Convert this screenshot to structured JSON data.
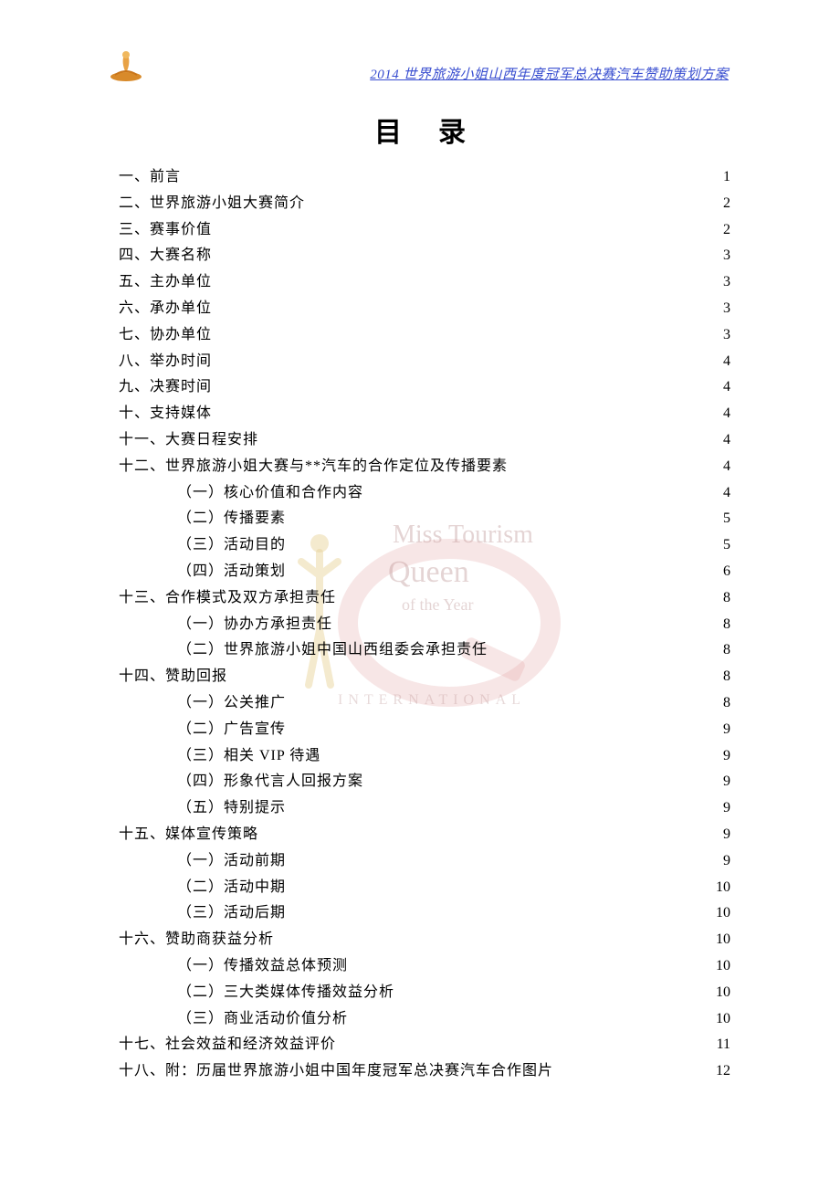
{
  "header": {
    "text": "2014 世界旅游小姐山西年度冠军总决赛汽车赞助策划方案"
  },
  "title": "目录",
  "watermark": {
    "line1": "Miss Tourism",
    "line2": "Queen",
    "line3": "of the Year",
    "line4": "INTERNATIONAL"
  },
  "toc": [
    {
      "label": "一、前言",
      "page": "1",
      "sub": false
    },
    {
      "label": "二、世界旅游小姐大赛简介",
      "page": "2",
      "sub": false
    },
    {
      "label": "三、赛事价值",
      "page": "2",
      "sub": false
    },
    {
      "label": "四、大赛名称",
      "page": "3",
      "sub": false
    },
    {
      "label": "五、主办单位",
      "page": "3",
      "sub": false
    },
    {
      "label": "六、承办单位",
      "page": "3",
      "sub": false
    },
    {
      "label": "七、协办单位",
      "page": "3",
      "sub": false
    },
    {
      "label": "八、举办时间",
      "page": "4",
      "sub": false
    },
    {
      "label": "九、决赛时间",
      "page": "4",
      "sub": false
    },
    {
      "label": "十、支持媒体",
      "page": "4",
      "sub": false
    },
    {
      "label": "十一、大赛日程安排",
      "page": "4",
      "sub": false
    },
    {
      "label": "十二、世界旅游小姐大赛与**汽车的合作定位及传播要素",
      "page": "4",
      "sub": false
    },
    {
      "label": "（一）核心价值和合作内容",
      "page": "4",
      "sub": true
    },
    {
      "label": "（二）传播要素",
      "page": "5",
      "sub": true
    },
    {
      "label": "（三）活动目的",
      "page": "5",
      "sub": true
    },
    {
      "label": "（四）活动策划",
      "page": "6",
      "sub": true
    },
    {
      "label": "十三、合作模式及双方承担责任",
      "page": "8",
      "sub": false
    },
    {
      "label": "（一）协办方承担责任",
      "page": "8",
      "sub": true
    },
    {
      "label": "（二）世界旅游小姐中国山西组委会承担责任",
      "page": "8",
      "sub": true
    },
    {
      "label": "十四、赞助回报",
      "page": "8",
      "sub": false
    },
    {
      "label": "（一）公关推广",
      "page": "8",
      "sub": true
    },
    {
      "label": "（二）广告宣传",
      "page": "9",
      "sub": true
    },
    {
      "label": "（三）相关 VIP 待遇",
      "page": "9",
      "sub": true
    },
    {
      "label": "（四）形象代言人回报方案",
      "page": "9",
      "sub": true
    },
    {
      "label": "（五）特别提示",
      "page": "9",
      "sub": true
    },
    {
      "label": "十五、媒体宣传策略",
      "page": "9",
      "sub": false,
      "nospace": true
    },
    {
      "label": "（一）活动前期",
      "page": "9",
      "sub": true
    },
    {
      "label": "（二）活动中期",
      "page": "10",
      "sub": true
    },
    {
      "label": "（三）活动后期",
      "page": "10",
      "sub": true
    },
    {
      "label": "十六、赞助商获益分析",
      "page": "10",
      "sub": false
    },
    {
      "label": "（一）传播效益总体预测",
      "page": "10",
      "sub": true
    },
    {
      "label": "（二）三大类媒体传播效益分析",
      "page": "10",
      "sub": true
    },
    {
      "label": "（三）商业活动价值分析",
      "page": "10",
      "sub": true
    },
    {
      "label": "十七、社会效益和经济效益评价",
      "page": "11",
      "sub": false
    },
    {
      "label": "十八、附：历届世界旅游小姐中国年度冠军总决赛汽车合作图片",
      "page": "12",
      "sub": false
    }
  ]
}
